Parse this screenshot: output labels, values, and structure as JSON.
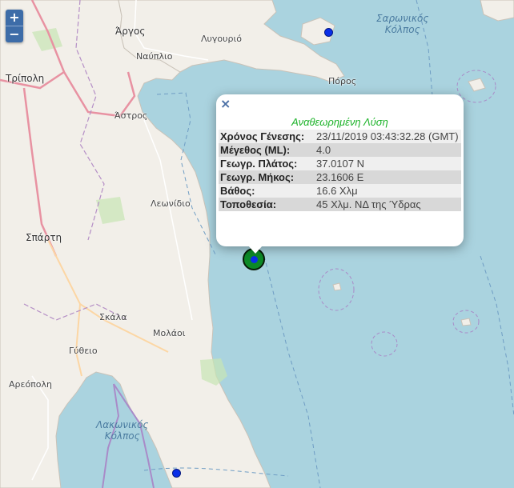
{
  "map": {
    "labels": {
      "argos": "Άργος",
      "nafplio": "Ναύπλιο",
      "lygourio": "Λυγουριό",
      "tripoli": "Τρίπολη",
      "poros": "Πόρος",
      "astros": "Άστρος",
      "leonidio": "Λεωνίδιο",
      "sparti": "Σπάρτη",
      "skala": "Σκάλα",
      "molaoi": "Μολάοι",
      "gytheio": "Γύθειο",
      "areopoli": "Αρεόπολη",
      "saronic_gulf": "Σαρωνικός\nΚόλπος",
      "laconian_gulf": "Λακωνικός\nΚόλπος"
    },
    "zoom_in_label": "+",
    "zoom_out_label": "−",
    "colors": {
      "sea": "#aad3df",
      "land": "#f2efe9",
      "event_fill": "#0c8a27",
      "event_core": "#0a2fe8"
    }
  },
  "popup": {
    "close_label": "×",
    "title": "Αναθεωρημένη Λύση",
    "rows": [
      {
        "label": "Χρόνος Γένεσης:",
        "value": "23/11/2019 03:43:32.28 (GMT)"
      },
      {
        "label": "Μέγεθος (ML):",
        "value": "4.0"
      },
      {
        "label": "Γεωγρ. Πλάτος:",
        "value": "37.0107 N"
      },
      {
        "label": "Γεωγρ. Μήκος:",
        "value": "23.1606 E"
      },
      {
        "label": "Βάθος:",
        "value": "16.6 Χλμ"
      },
      {
        "label": "Τοποθεσία:",
        "value": "45 Χλμ. ΝΔ της Ύδρας"
      }
    ]
  }
}
